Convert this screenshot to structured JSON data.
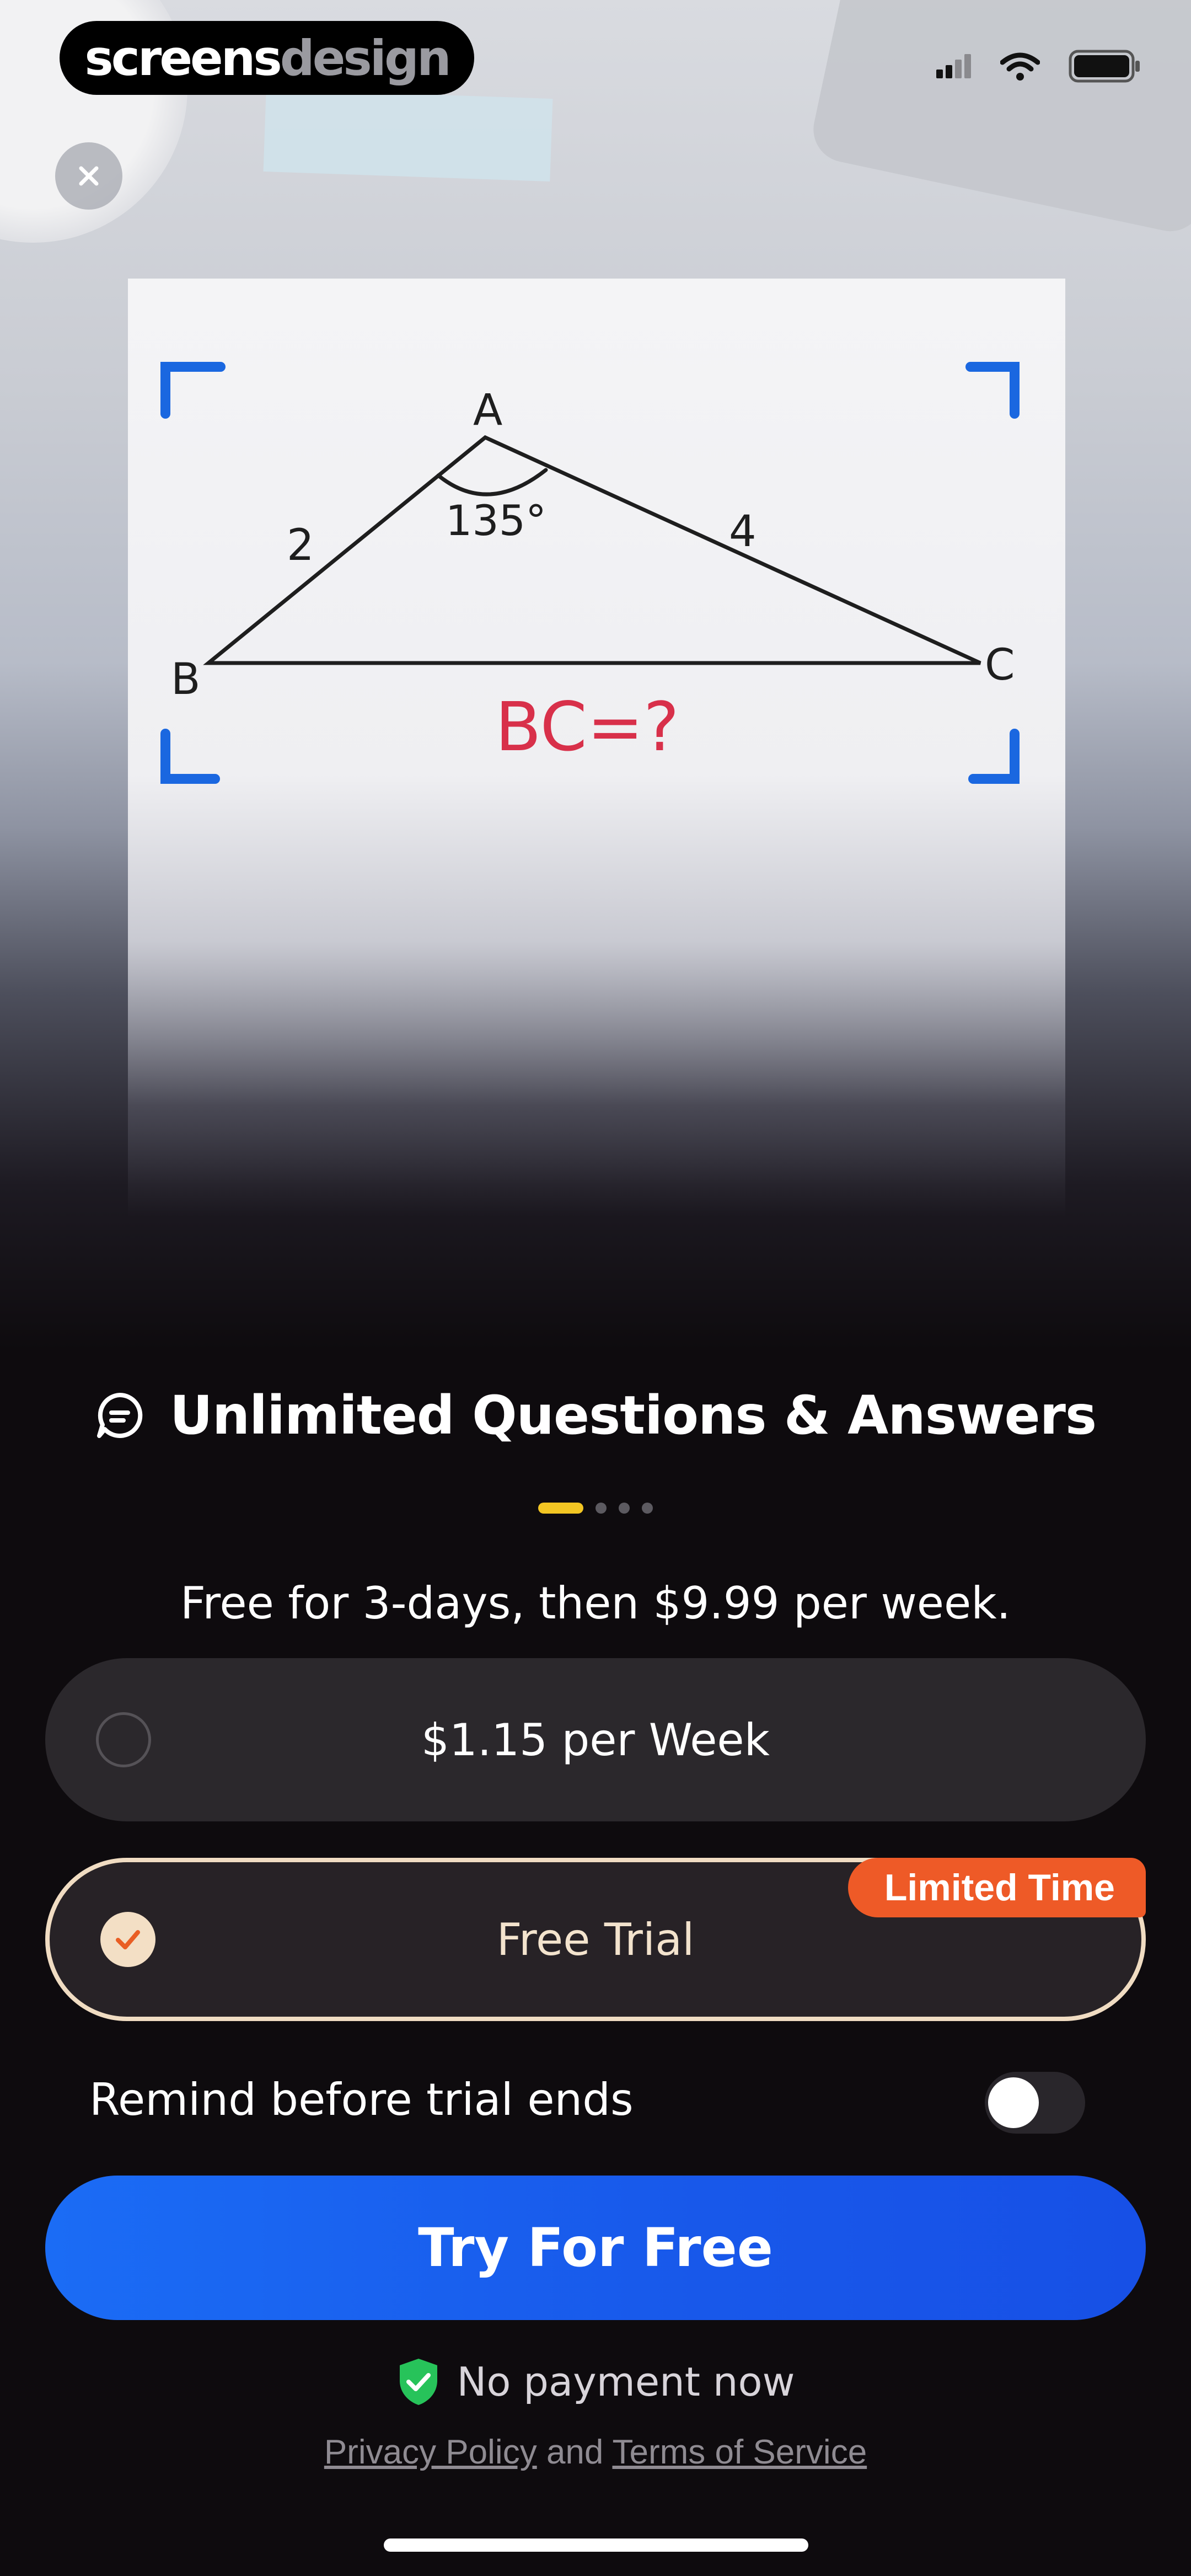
{
  "brand": {
    "logo_main": "screens",
    "logo_accent": "design"
  },
  "status_bar": {
    "icons": [
      "cellular-signal-icon",
      "wifi-icon",
      "battery-icon"
    ]
  },
  "close_button": {
    "icon": "close-icon"
  },
  "problem_image": {
    "vertex_a": "A",
    "vertex_b": "B",
    "vertex_c": "C",
    "side_ab": "2",
    "side_ac": "4",
    "angle_a": "135°",
    "question": "BC=?"
  },
  "feature": {
    "icon": "chat-bubble-icon",
    "title": "Unlimited Questions & Answers"
  },
  "pagination": {
    "count": 4,
    "active_index": 0
  },
  "offer_text": "Free for 3-days, then $9.99 per week.",
  "plans": [
    {
      "label": "$1.15 per Week",
      "selected": false
    },
    {
      "label": "Free Trial",
      "selected": true,
      "badge": "Limited Time"
    }
  ],
  "reminder": {
    "label": "Remind before trial ends",
    "enabled": false
  },
  "cta_label": "Try For Free",
  "assurance": {
    "icon": "shield-check-icon",
    "text": "No payment now"
  },
  "footer": {
    "privacy": "Privacy Policy",
    "joiner": "and",
    "terms": "Terms of Service"
  },
  "colors": {
    "accent_blue": "#1b6cf5",
    "badge_orange": "#ee5a27",
    "active_dot": "#f3c623",
    "selected_outline": "#f0dcc2",
    "shield_green": "#27c35a"
  }
}
